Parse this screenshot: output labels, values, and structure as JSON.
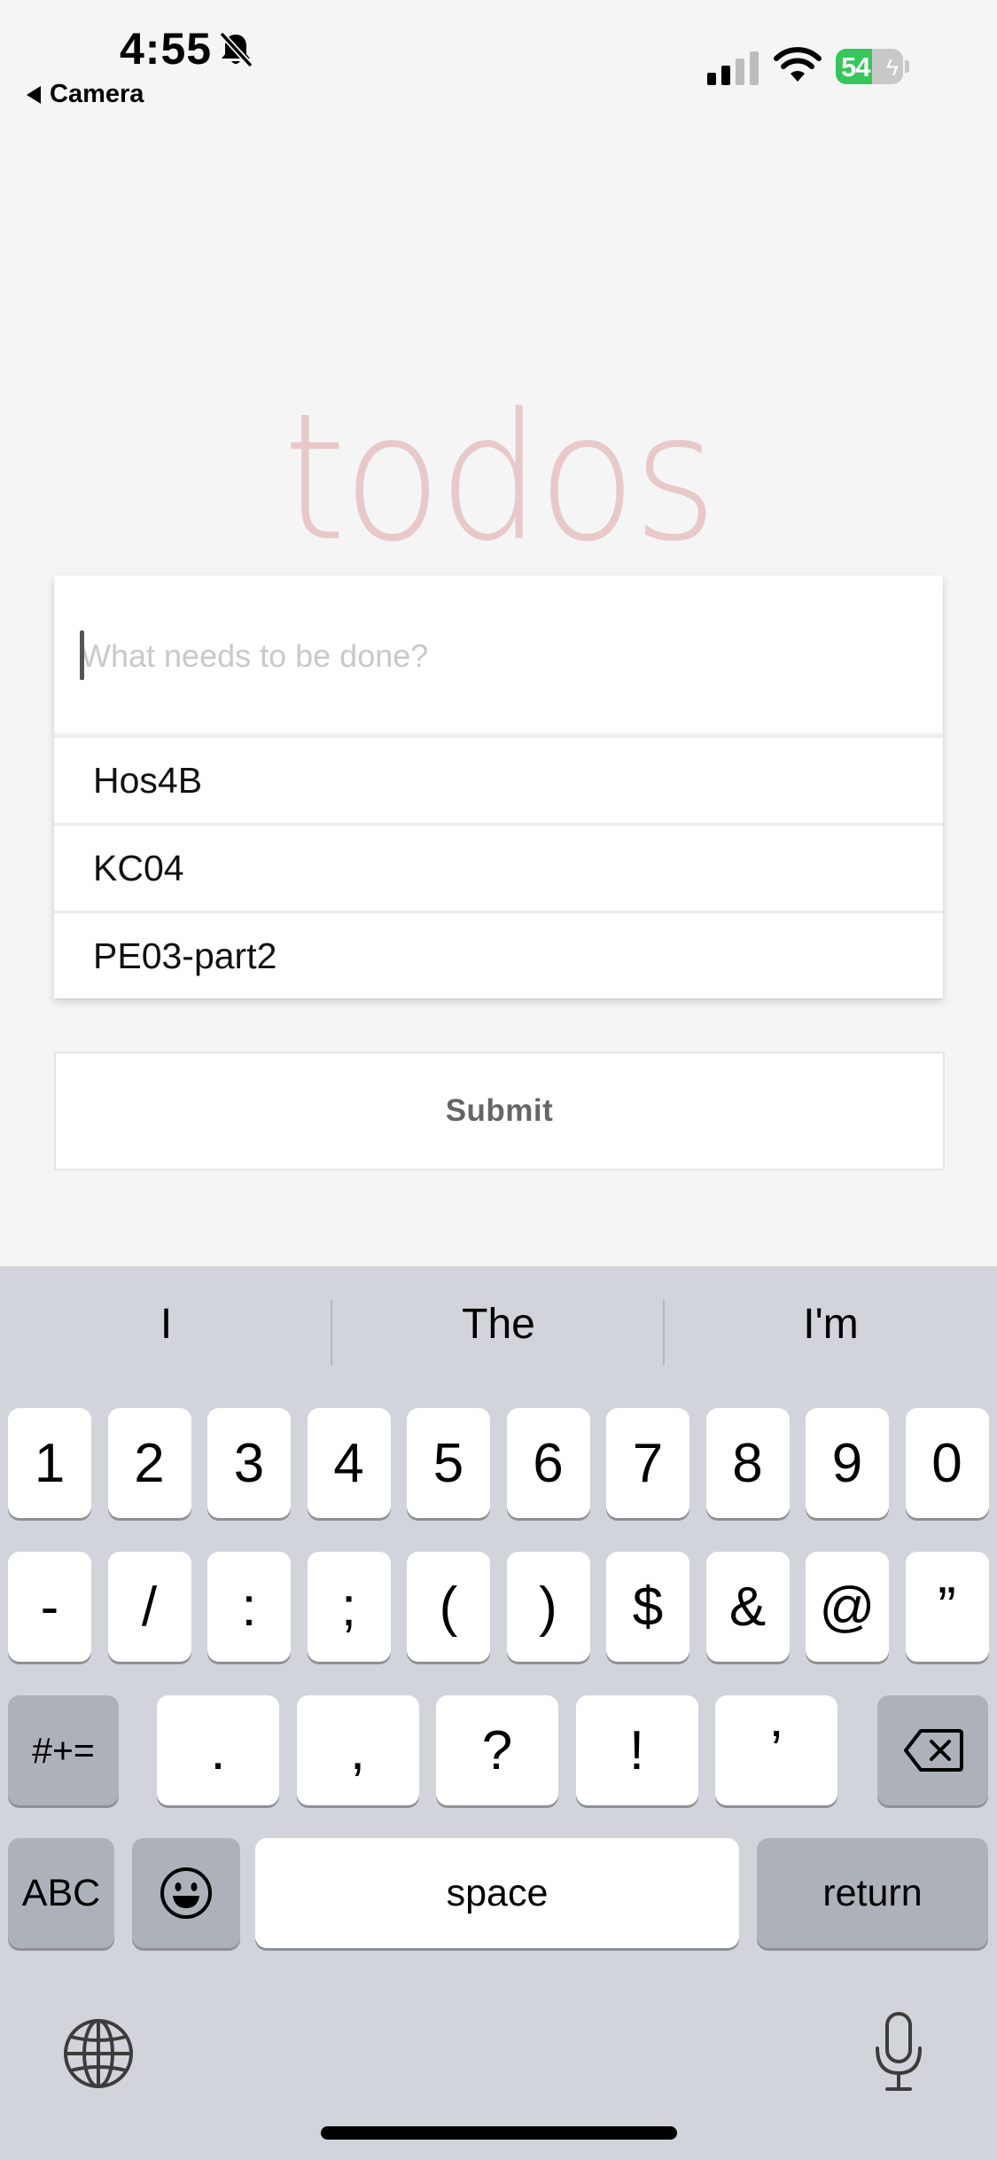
{
  "status_bar": {
    "time": "4:55",
    "back_app": "Camera",
    "battery_percent": "54",
    "battery_level": 0.54
  },
  "app": {
    "title": "todos",
    "new_todo_placeholder": "What needs to be done?",
    "todos": [
      "Hos4B",
      "KC04",
      "PE03-part2"
    ],
    "submit_label": "Submit"
  },
  "keyboard": {
    "suggestions": [
      "I",
      "The",
      "I'm"
    ],
    "row1": [
      "1",
      "2",
      "3",
      "4",
      "5",
      "6",
      "7",
      "8",
      "9",
      "0"
    ],
    "row2": [
      "-",
      "/",
      ":",
      ";",
      "(",
      ")",
      "$",
      "&",
      "@",
      "”"
    ],
    "row3_symbols_key": "#+=",
    "row3": [
      ".",
      ",",
      "?",
      "!",
      "’"
    ],
    "abc_key": "ABC",
    "space_key": "space",
    "return_key": "return"
  }
}
